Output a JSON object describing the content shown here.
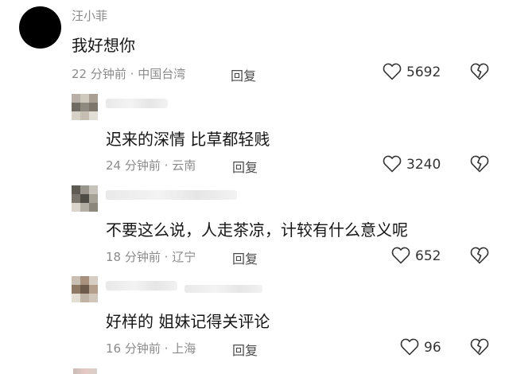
{
  "comments": [
    {
      "username": "汪小菲",
      "text": "我好想你",
      "time": "22 分钟前",
      "location": "中国台湾",
      "reply_label": "回复",
      "likes": "5692",
      "avatar": "black-circle"
    },
    {
      "username": "",
      "text": "迟来的深情  比草都轻贱",
      "time": "24 分钟前",
      "location": "云南",
      "reply_label": "回复",
      "likes": "3240",
      "avatar": "pixelated"
    },
    {
      "username": "",
      "text": "不要这么说，人走茶凉，计较有什么意义呢",
      "time": "18 分钟前",
      "location": "辽宁",
      "reply_label": "回复",
      "likes": "652",
      "avatar": "pixelated"
    },
    {
      "username": "",
      "text": "好样的 姐妹记得关评论",
      "time": "16 分钟前",
      "location": "上海",
      "reply_label": "回复",
      "likes": "96",
      "avatar": "pixelated"
    }
  ],
  "separator": "·",
  "icons": {
    "like": "heart-icon",
    "dislike": "broken-heart-icon"
  },
  "colors": {
    "text": "#161616",
    "meta": "#8b8b8b",
    "icon": "#333333"
  }
}
